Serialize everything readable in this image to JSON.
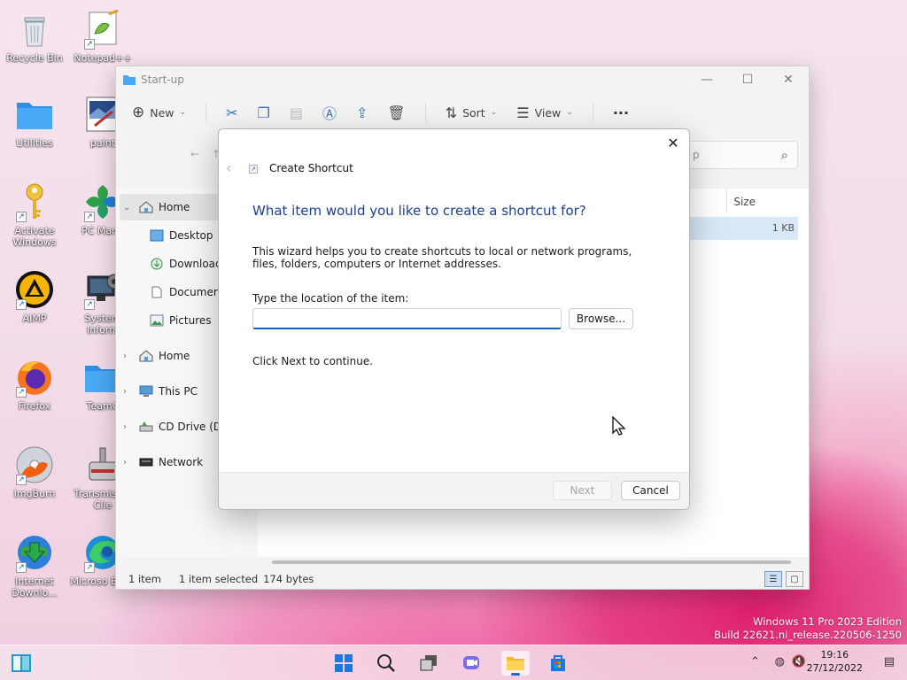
{
  "desktop": {
    "icons": [
      {
        "label": "Recycle Bin"
      },
      {
        "label": "Notepad++"
      },
      {
        "label": "Utilities"
      },
      {
        "label": "paint"
      },
      {
        "label": "Activate Windows"
      },
      {
        "label": "PC Mana"
      },
      {
        "label": "AIMP"
      },
      {
        "label": "System Inform"
      },
      {
        "label": "Firefox"
      },
      {
        "label": "TeamC"
      },
      {
        "label": "ImgBurn"
      },
      {
        "label": "Transmis Qt Clie"
      },
      {
        "label": "Internet Downlo..."
      },
      {
        "label": "Microso Edge"
      }
    ]
  },
  "explorer": {
    "title": "Start-up",
    "toolbar": {
      "new_label": "New",
      "sort_label": "Sort",
      "view_label": "View",
      "more_label": "···"
    },
    "search_placeholder": "p",
    "nav": {
      "home": "Home",
      "desktop": "Desktop",
      "downloads": "Downloads",
      "documents": "Documents",
      "pictures": "Pictures",
      "home2": "Home",
      "this_pc": "This PC",
      "cd_drive": "CD Drive (D:",
      "network": "Network"
    },
    "columns": {
      "size": "Size"
    },
    "row": {
      "size": "1 KB"
    },
    "status": {
      "items": "1 item",
      "selected": "1 item selected",
      "bytes": "174 bytes"
    }
  },
  "dialog": {
    "title": "Create Shortcut",
    "heading": "What item would you like to create a shortcut for?",
    "description": "This wizard helps you to create shortcuts to local or network programs, files, folders, computers or Internet addresses.",
    "location_label": "Type the location of the item:",
    "location_value": "",
    "browse_label": "Browse...",
    "continue_text": "Click Next to continue.",
    "next_label": "Next",
    "cancel_label": "Cancel",
    "close_label": "✕"
  },
  "watermark": {
    "line1": "Windows 11 Pro 2023 Edition",
    "line2": "Build 22621.ni_release.220506-1250"
  },
  "taskbar": {
    "time": "19:16",
    "date": "27/12/2022"
  },
  "colors": {
    "accent": "#1a5fb4",
    "heading": "#1c3f8f",
    "wallpaper_pink": "#e0206e"
  }
}
